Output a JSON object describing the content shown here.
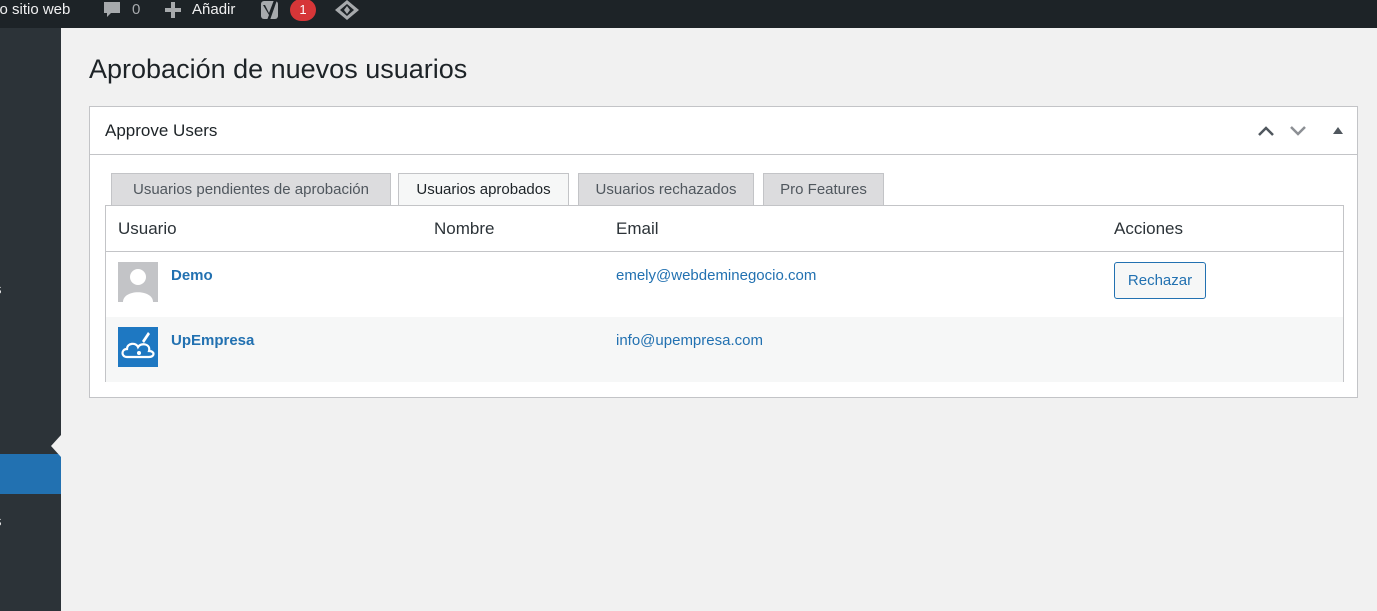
{
  "adminbar": {
    "site_name": "vo sitio web",
    "comments_count": "0",
    "new_label": "Añadir",
    "notifications_count": "1"
  },
  "sidebar": {
    "fragment_1": "s",
    "fragment_2": "s"
  },
  "page": {
    "title": "Aprobación de nuevos usuarios"
  },
  "postbox": {
    "title": "Approve Users"
  },
  "tabs": [
    {
      "label": "Usuarios pendientes de aprobación"
    },
    {
      "label": "Usuarios aprobados"
    },
    {
      "label": "Usuarios rechazados"
    },
    {
      "label": "Pro Features"
    }
  ],
  "table": {
    "columns": [
      "Usuario",
      "Nombre",
      "Email",
      "Acciones"
    ],
    "rows": [
      {
        "user": "Demo",
        "name": "",
        "email": "emely@webdeminegocio.com",
        "action": "Rechazar"
      },
      {
        "user": "UpEmpresa",
        "name": "",
        "email": "info@upempresa.com",
        "action": ""
      }
    ]
  },
  "colors": {
    "adminbar_bg": "#1d2327",
    "sidebar_bg": "#2c3338",
    "accent": "#2271b1",
    "badge": "#d63638"
  },
  "icons": {
    "comments": "comment-bubble-icon",
    "new": "plus-icon",
    "yoast": "yoast-icon",
    "diamond": "diamond-icon",
    "move_up": "chevron-up-icon",
    "move_down": "chevron-down-icon",
    "toggle": "triangle-up-icon"
  }
}
